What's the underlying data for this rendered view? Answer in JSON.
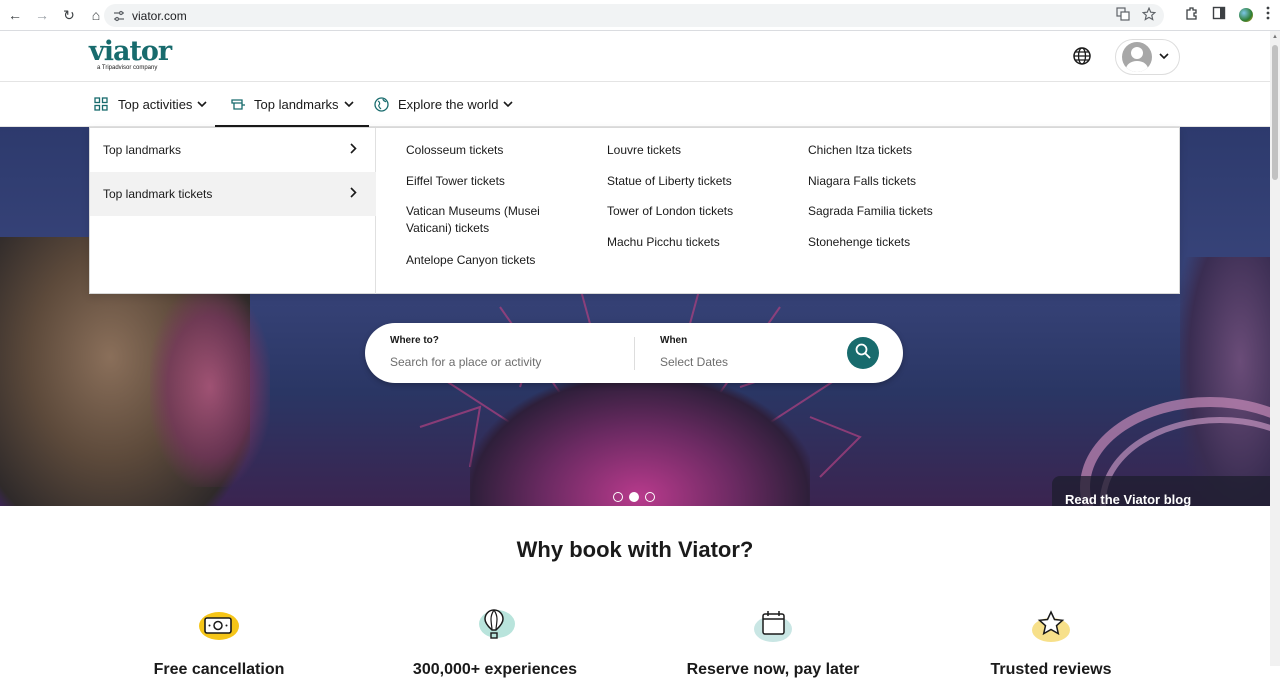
{
  "browser": {
    "url": "viator.com",
    "back": "←",
    "forward": "→",
    "reload": "↻",
    "home": "⌂"
  },
  "header": {
    "logo_text": "viator",
    "logo_tagline": "a Tripadvisor company"
  },
  "nav": {
    "tabs": [
      {
        "label": "Top activities",
        "icon": "grid-icon"
      },
      {
        "label": "Top landmarks",
        "icon": "landmark-icon",
        "active": true
      },
      {
        "label": "Explore the world",
        "icon": "globe-icon"
      }
    ]
  },
  "dropdown": {
    "categories": [
      {
        "label": "Top landmarks"
      },
      {
        "label": "Top landmark tickets",
        "selected": true
      }
    ],
    "links": {
      "col1": [
        "Colosseum tickets",
        "Eiffel Tower tickets",
        "Vatican Museums (Musei Vaticani) tickets",
        "Antelope Canyon tickets"
      ],
      "col2": [
        "Louvre tickets",
        "Statue of Liberty tickets",
        "Tower of London tickets",
        "Machu Picchu tickets"
      ],
      "col3": [
        "Chichen Itza tickets",
        "Niagara Falls tickets",
        "Sagrada Familia tickets",
        "Stonehenge tickets"
      ]
    }
  },
  "search": {
    "where_label": "Where to?",
    "where_placeholder": "Search for a place or activity",
    "when_label": "When",
    "when_placeholder": "Select Dates"
  },
  "hero": {
    "blog_link": "Read the Viator blog",
    "carousel_active_index": 1,
    "carousel_count": 3
  },
  "why": {
    "title": "Why book with Viator?",
    "features": [
      {
        "title": "Free cancellation",
        "icon": "money-icon",
        "accent": "#f5c518"
      },
      {
        "title": "300,000+ experiences",
        "icon": "balloon-icon",
        "accent": "#b9e4dc"
      },
      {
        "title": "Reserve now, pay later",
        "icon": "calendar-icon",
        "accent": "#c9e6e4"
      },
      {
        "title": "Trusted reviews",
        "icon": "star-icon",
        "accent": "#f7e08a"
      }
    ]
  },
  "colors": {
    "brand": "#186b6d",
    "text": "#1a1a1a"
  }
}
